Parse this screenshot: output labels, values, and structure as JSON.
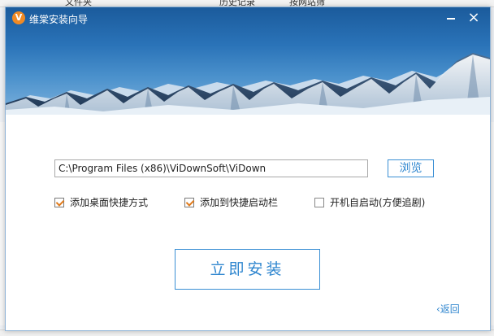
{
  "background": {
    "fragments": [
      "文件夹",
      "历史记录",
      "按网站筛"
    ]
  },
  "window": {
    "title": "维棠安装向导",
    "logo_glyph": "V",
    "colors": {
      "accent": "#2f86cf",
      "checkbox_tick": "#e07a1a",
      "banner_sky": "#2a73b8"
    }
  },
  "install": {
    "path_value": "C:\\Program Files (x86)\\ViDownSoft\\ViDown",
    "browse_label": "浏览",
    "options": [
      {
        "label": "添加桌面快捷方式",
        "checked": true
      },
      {
        "label": "添加到快捷启动栏",
        "checked": true
      },
      {
        "label": "开机自启动(方便追剧)",
        "checked": false
      }
    ],
    "install_label": "立即安装",
    "back_label": "‹返回"
  },
  "icons": {
    "minimize": "minimize-icon",
    "close": "close-icon",
    "logo": "vidown-logo-icon"
  }
}
